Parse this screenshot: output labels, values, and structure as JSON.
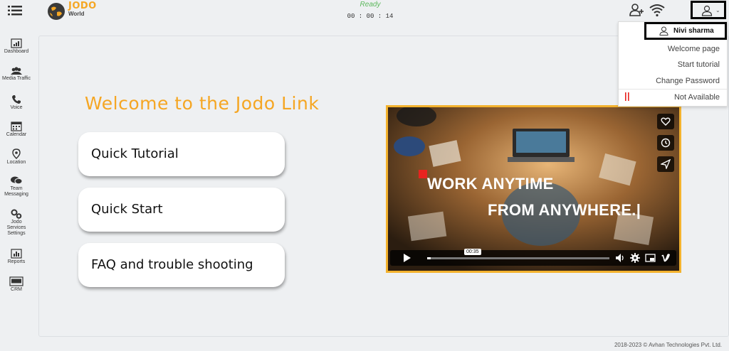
{
  "header": {
    "logo_line1": "JODO",
    "logo_line2": "World",
    "status": "Ready",
    "timer": "00 : 00 : 14"
  },
  "sidebar": {
    "items": [
      {
        "label": "Dashboard"
      },
      {
        "label": "Media Traffic"
      },
      {
        "label": "Voice"
      },
      {
        "label": "Calendar"
      },
      {
        "label": "Location"
      },
      {
        "label_line1": "Team",
        "label_line2": "Messaging"
      },
      {
        "label_line1": "Jodo",
        "label_line2": "Services",
        "label_line3": "Settings"
      },
      {
        "label": "Reports"
      },
      {
        "label": "CRM"
      }
    ]
  },
  "main": {
    "welcome": "Welcome to the Jodo Link",
    "buttons": [
      "Quick Tutorial",
      "Quick Start",
      "FAQ and trouble shooting"
    ]
  },
  "video": {
    "line1": "WORK ANYTIME",
    "line2": "FROM ANYWHERE.|",
    "time": "00:35",
    "progress_fraction": 0.02
  },
  "dropdown": {
    "user_name": "Nivi sharma",
    "items": [
      "Welcome page",
      "Start tutorial",
      "Change Password"
    ],
    "status": "Not Available"
  },
  "footer": "2018-2023 © Avhan Technologies Pvt. Ltd.",
  "colors": {
    "accent": "#f5a623",
    "ready": "#5cb85c",
    "video_border": "#f3b22e",
    "not_available": "#e8231f"
  }
}
